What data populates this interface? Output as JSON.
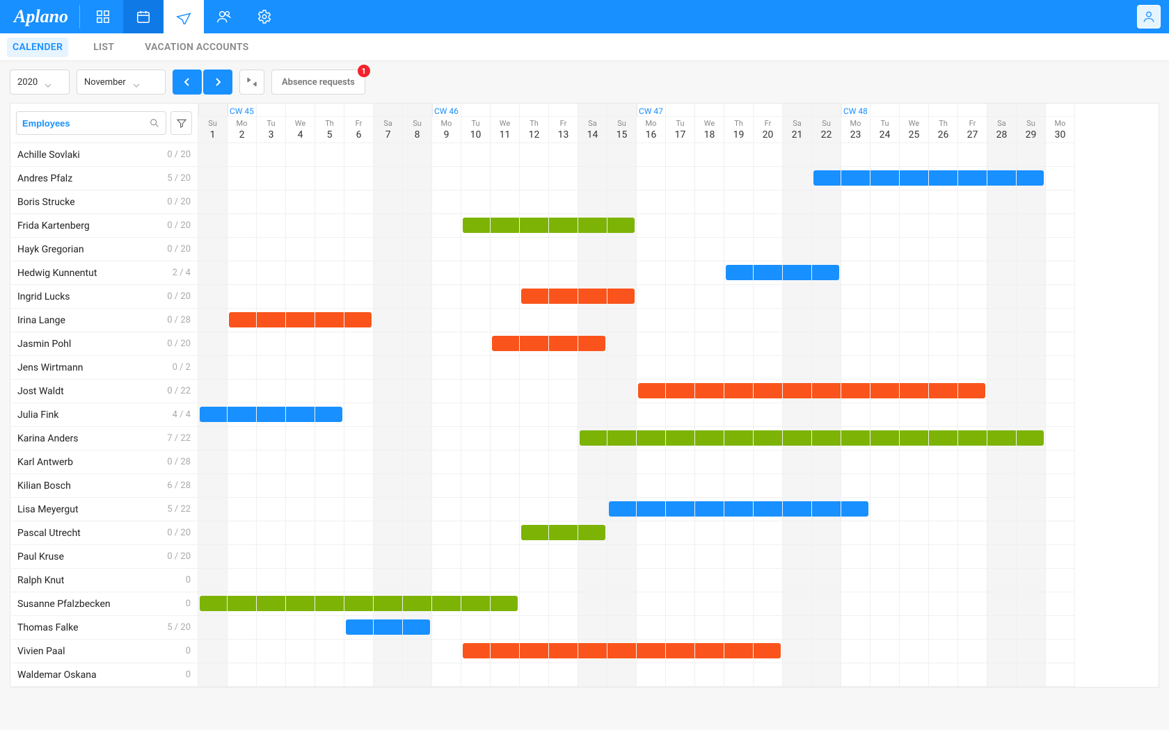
{
  "brand": "Aplano",
  "subnav": {
    "calendar": "CALENDER",
    "list": "LIST",
    "vacation": "VACATION ACCOUNTS"
  },
  "toolbar": {
    "year": "2020",
    "month": "November",
    "requests": "Absence requests",
    "requests_badge": "1"
  },
  "employees_placeholder": "Employees",
  "weeks": [
    {
      "label": "CW 45",
      "start": 2
    },
    {
      "label": "CW 46",
      "start": 9
    },
    {
      "label": "CW 47",
      "start": 16
    },
    {
      "label": "CW 48",
      "start": 23
    }
  ],
  "days": [
    {
      "dow": "Su",
      "d": "1",
      "w": true
    },
    {
      "dow": "Mo",
      "d": "2"
    },
    {
      "dow": "Tu",
      "d": "3"
    },
    {
      "dow": "We",
      "d": "4"
    },
    {
      "dow": "Th",
      "d": "5"
    },
    {
      "dow": "Fr",
      "d": "6"
    },
    {
      "dow": "Sa",
      "d": "7",
      "w": true
    },
    {
      "dow": "Su",
      "d": "8",
      "w": true
    },
    {
      "dow": "Mo",
      "d": "9"
    },
    {
      "dow": "Tu",
      "d": "10"
    },
    {
      "dow": "We",
      "d": "11"
    },
    {
      "dow": "Th",
      "d": "12"
    },
    {
      "dow": "Fr",
      "d": "13"
    },
    {
      "dow": "Sa",
      "d": "14",
      "w": true
    },
    {
      "dow": "Su",
      "d": "15",
      "w": true
    },
    {
      "dow": "Mo",
      "d": "16"
    },
    {
      "dow": "Tu",
      "d": "17"
    },
    {
      "dow": "We",
      "d": "18"
    },
    {
      "dow": "Th",
      "d": "19"
    },
    {
      "dow": "Fr",
      "d": "20"
    },
    {
      "dow": "Sa",
      "d": "21",
      "w": true
    },
    {
      "dow": "Su",
      "d": "22",
      "w": true
    },
    {
      "dow": "Mo",
      "d": "23"
    },
    {
      "dow": "Tu",
      "d": "24"
    },
    {
      "dow": "We",
      "d": "25"
    },
    {
      "dow": "Th",
      "d": "26"
    },
    {
      "dow": "Fr",
      "d": "27"
    },
    {
      "dow": "Sa",
      "d": "28",
      "w": true
    },
    {
      "dow": "Su",
      "d": "29",
      "w": true
    },
    {
      "dow": "Mo",
      "d": "30"
    }
  ],
  "rows": [
    {
      "name": "Achille Sovlaki",
      "count": "0 / 20",
      "bars": []
    },
    {
      "name": "Andres Pfalz",
      "count": "5 / 20",
      "bars": [
        {
          "s": 22,
          "e": 29,
          "c": "blue"
        }
      ]
    },
    {
      "name": "Boris Strucke",
      "count": "0 / 20",
      "bars": []
    },
    {
      "name": "Frida Kartenberg",
      "count": "0 / 20",
      "bars": [
        {
          "s": 10,
          "e": 15,
          "c": "green"
        }
      ]
    },
    {
      "name": "Hayk Gregorian",
      "count": "0 / 20",
      "bars": []
    },
    {
      "name": "Hedwig Kunnentut",
      "count": "2 / 4",
      "bars": [
        {
          "s": 19,
          "e": 22,
          "c": "blue"
        }
      ]
    },
    {
      "name": "Ingrid Lucks",
      "count": "0 / 20",
      "bars": [
        {
          "s": 12,
          "e": 15,
          "c": "orange"
        }
      ]
    },
    {
      "name": "Irina Lange",
      "count": "0 / 28",
      "bars": [
        {
          "s": 2,
          "e": 6,
          "c": "orange"
        }
      ]
    },
    {
      "name": "Jasmin Pohl",
      "count": "0 / 20",
      "bars": [
        {
          "s": 11,
          "e": 14,
          "c": "orange"
        }
      ]
    },
    {
      "name": "Jens Wirtmann",
      "count": "0 / 2",
      "bars": []
    },
    {
      "name": "Jost Waldt",
      "count": "0 / 22",
      "bars": [
        {
          "s": 16,
          "e": 27,
          "c": "orange"
        }
      ]
    },
    {
      "name": "Julia Fink",
      "count": "4 / 4",
      "bars": [
        {
          "s": 1,
          "e": 5,
          "c": "blue"
        }
      ]
    },
    {
      "name": "Karina Anders",
      "count": "7 / 22",
      "bars": [
        {
          "s": 14,
          "e": 29,
          "c": "green"
        }
      ]
    },
    {
      "name": "Karl Antwerb",
      "count": "0 / 28",
      "bars": []
    },
    {
      "name": "Kilian Bosch",
      "count": "6 / 28",
      "bars": []
    },
    {
      "name": "Lisa Meyergut",
      "count": "5 / 22",
      "bars": [
        {
          "s": 15,
          "e": 23,
          "c": "blue"
        }
      ]
    },
    {
      "name": "Pascal Utrecht",
      "count": "0 / 20",
      "bars": [
        {
          "s": 12,
          "e": 14,
          "c": "green"
        }
      ]
    },
    {
      "name": "Paul Kruse",
      "count": "0 / 20",
      "bars": []
    },
    {
      "name": "Ralph Knut",
      "count": "0",
      "bars": []
    },
    {
      "name": "Susanne Pfalzbecken",
      "count": "0",
      "bars": [
        {
          "s": 1,
          "e": 11,
          "c": "green"
        }
      ]
    },
    {
      "name": "Thomas Falke",
      "count": "5 / 20",
      "bars": [
        {
          "s": 6,
          "e": 8,
          "c": "blue"
        }
      ]
    },
    {
      "name": "Vivien Paal",
      "count": "0",
      "bars": [
        {
          "s": 10,
          "e": 20,
          "c": "orange"
        }
      ]
    },
    {
      "name": "Waldemar Oskana",
      "count": "0",
      "bars": []
    }
  ]
}
